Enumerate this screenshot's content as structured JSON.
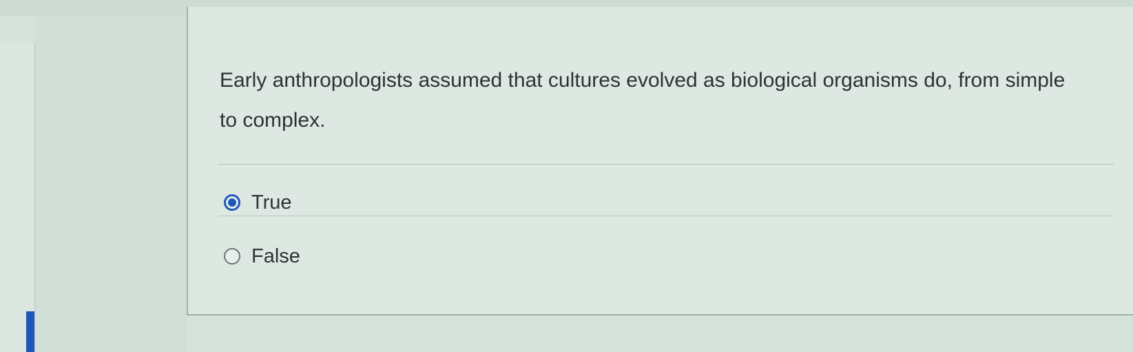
{
  "question": {
    "text": "Early anthropologists assumed that cultures evolved as biological organisms do, from simple to complex."
  },
  "options": [
    {
      "label": "True",
      "selected": true
    },
    {
      "label": "False",
      "selected": false
    }
  ],
  "colors": {
    "accent": "#1f56b8",
    "background": "#dde8e2",
    "text": "#2d3331"
  }
}
